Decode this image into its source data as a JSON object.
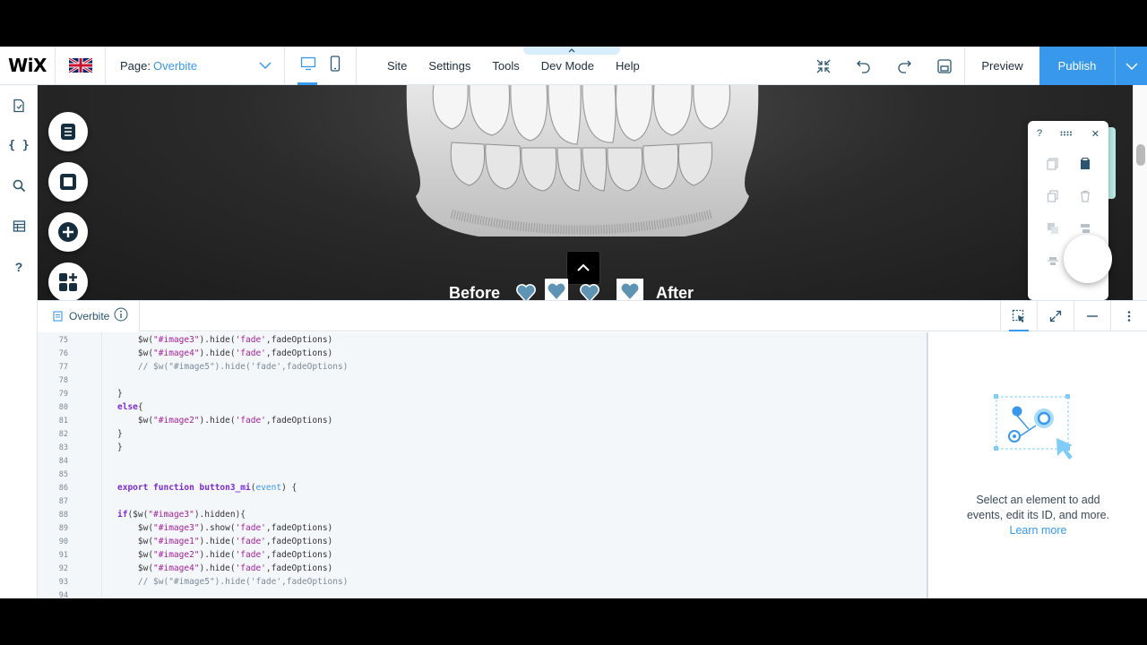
{
  "app": {
    "logo": "WiX",
    "page_label": "Page:",
    "page_value": "Overbite",
    "menu": [
      "Site",
      "Settings",
      "Tools",
      "Dev Mode",
      "Help"
    ],
    "preview": "Preview",
    "publish": "Publish"
  },
  "canvas": {
    "before_label": "Before",
    "after_label": "After"
  },
  "code_panel": {
    "file_tab": "Overbite",
    "lines": [
      {
        "n": "75",
        "html": "    $w(<span class=\"str\">\"#image3\"</span>).hide(<span class=\"str\">'fade'</span>,fadeOptions)"
      },
      {
        "n": "76",
        "html": "    $w(<span class=\"str\">\"#image4\"</span>).hide(<span class=\"str\">'fade'</span>,fadeOptions)"
      },
      {
        "n": "77",
        "html": "    <span class=\"cm\">// $w(\"#image5\").hide('fade',fadeOptions)</span>"
      },
      {
        "n": "78",
        "html": ""
      },
      {
        "n": "79",
        "html": "}"
      },
      {
        "n": "80",
        "html": "<span class=\"kw\">else</span>{"
      },
      {
        "n": "81",
        "html": "    $w(<span class=\"str\">\"#image2\"</span>).hide(<span class=\"str\">'fade'</span>,fadeOptions)"
      },
      {
        "n": "82",
        "html": "}"
      },
      {
        "n": "83",
        "html": "}"
      },
      {
        "n": "84",
        "html": ""
      },
      {
        "n": "85",
        "html": ""
      },
      {
        "n": "86",
        "html": "<span class=\"kw\">export function</span> <span class=\"fn\">button3_mi</span>(<span class=\"arg\">event</span>) {"
      },
      {
        "n": "87",
        "html": ""
      },
      {
        "n": "88",
        "html": "<span class=\"kw\">if</span>($w(<span class=\"str\">\"#image3\"</span>).hidden){"
      },
      {
        "n": "89",
        "html": "    $w(<span class=\"str\">\"#image3\"</span>).show(<span class=\"str\">'fade'</span>,fadeOptions)"
      },
      {
        "n": "90",
        "html": "    $w(<span class=\"str\">\"#image1\"</span>).hide(<span class=\"str\">'fade'</span>,fadeOptions)"
      },
      {
        "n": "91",
        "html": "    $w(<span class=\"str\">\"#image2\"</span>).hide(<span class=\"str\">'fade'</span>,fadeOptions)"
      },
      {
        "n": "92",
        "html": "    $w(<span class=\"str\">\"#image4\"</span>).hide(<span class=\"str\">'fade'</span>,fadeOptions)"
      },
      {
        "n": "93",
        "html": "    <span class=\"cm\">// $w(\"#image5\").hide('fade',fadeOptions)</span>"
      },
      {
        "n": "94",
        "html": ""
      }
    ]
  },
  "properties": {
    "message_line1": "Select an element to add",
    "message_line2": "events, edit its ID, and more.",
    "learn_more": "Learn more"
  },
  "colors": {
    "accent": "#3899ec",
    "keyword": "#7a2bd6",
    "string": "#a31f9a",
    "comment": "#7b8a98"
  }
}
